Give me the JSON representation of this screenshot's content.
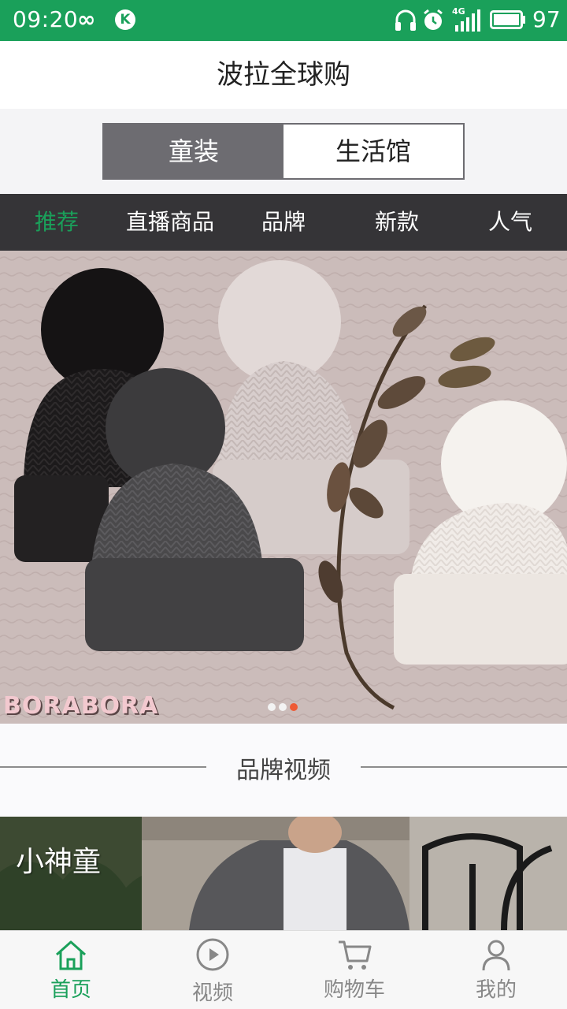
{
  "status_bar": {
    "time": "09:20",
    "loop_glyph": "∞",
    "k_badge": "K",
    "network": "4G",
    "battery": "97"
  },
  "header": {
    "title": "波拉全球购"
  },
  "segment": {
    "items": [
      "童装",
      "生活馆"
    ],
    "selected": "童装"
  },
  "categories": {
    "items": [
      "推荐",
      "直播商品",
      "品牌",
      "新款",
      "人气"
    ],
    "selected": "推荐",
    "accent": "#1aa05a"
  },
  "banner": {
    "logo_text": "BORABORA",
    "dot_count": 3,
    "active_dot": 3
  },
  "brand_video": {
    "section_title": "品牌视频",
    "brand_name": "小神童"
  },
  "tab_bar": {
    "items": [
      {
        "label": "首页",
        "icon": "home-icon"
      },
      {
        "label": "视频",
        "icon": "play-icon"
      },
      {
        "label": "购物车",
        "icon": "cart-icon"
      },
      {
        "label": "我的",
        "icon": "user-icon"
      }
    ],
    "selected": "首页"
  },
  "colors": {
    "brand_green": "#1aa05a",
    "segment_gray": "#6d6c71",
    "category_bg": "#353437",
    "dot_active": "#ee5a35"
  }
}
